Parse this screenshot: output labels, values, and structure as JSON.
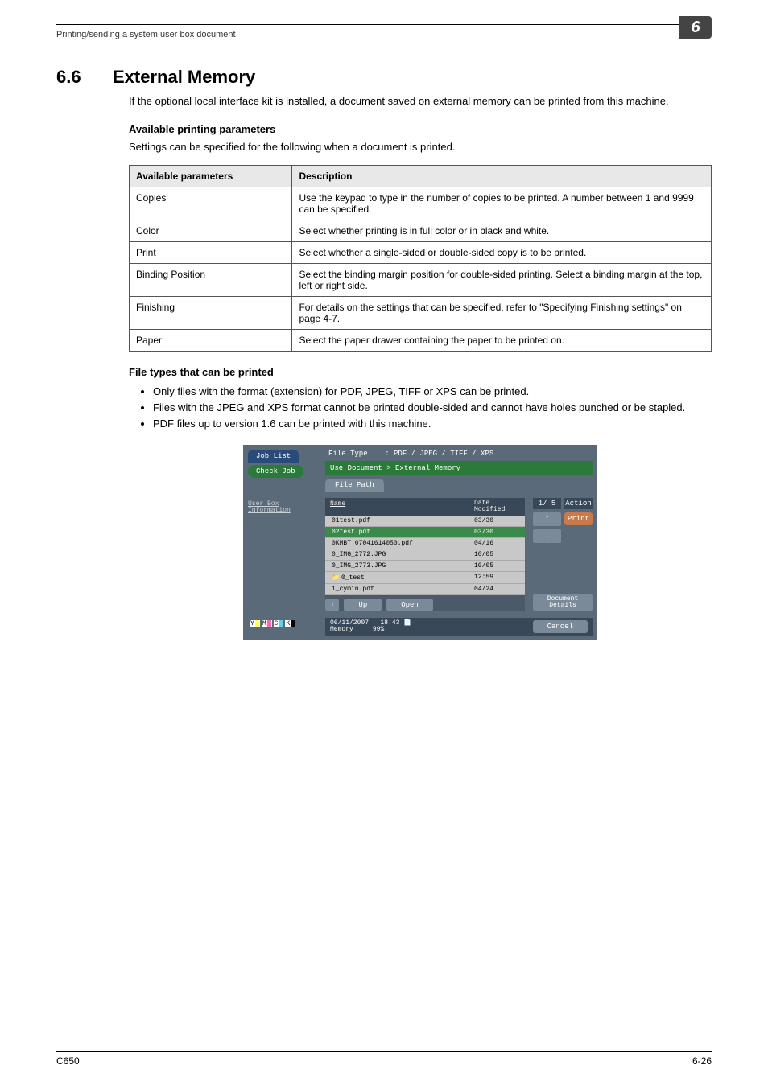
{
  "header": {
    "breadcrumb": "Printing/sending a system user box document",
    "chapter": "6"
  },
  "section": {
    "number": "6.6",
    "title": "External Memory",
    "intro": "If the optional local interface kit is installed, a document saved on external memory can be printed from this machine."
  },
  "params_section": {
    "heading": "Available printing parameters",
    "lead": "Settings can be specified for the following when a document is printed.",
    "th1": "Available parameters",
    "th2": "Description",
    "rows": [
      {
        "p": "Copies",
        "d": "Use the keypad to type in the number of copies to be printed. A number between 1 and 9999 can be specified."
      },
      {
        "p": "Color",
        "d": "Select whether printing is in full color or in black and white."
      },
      {
        "p": "Print",
        "d": "Select whether a single-sided or double-sided copy is to be printed."
      },
      {
        "p": "Binding Position",
        "d": "Select the binding margin position for double-sided printing. Select a binding margin at the top, left or right side."
      },
      {
        "p": "Finishing",
        "d": "For details on the settings that can be specified, refer to \"Specifying Finishing settings\" on page 4-7."
      },
      {
        "p": "Paper",
        "d": "Select the paper drawer containing the paper to be printed on."
      }
    ]
  },
  "filetypes": {
    "heading": "File types that can be printed",
    "bullets": [
      "Only files with the format (extension) for PDF, JPEG, TIFF or XPS can be printed.",
      "Files with the JPEG and XPS format cannot be printed double-sided and cannot have holes punched or be stapled.",
      "PDF files up to version 1.6 can be printed with this machine."
    ]
  },
  "screenshot": {
    "job_list": "Job List",
    "check_job": "Check Job",
    "file_type_label": "File Type",
    "file_type_val": ": PDF / JPEG / TIFF / XPS",
    "crumb": "Use Document > External Memory",
    "file_path_tab": "File Path",
    "user_box_info": "User Box\nInformation",
    "col_name": "Name",
    "col_date": "Date\nModified",
    "files": [
      {
        "n": "01test.pdf",
        "d": "03/30",
        "sel": false
      },
      {
        "n": "02test.pdf",
        "d": "03/30",
        "sel": true
      },
      {
        "n": "0KMBT_07041614050.pdf",
        "d": "04/16",
        "sel": false
      },
      {
        "n": "0_IMG_2772.JPG",
        "d": "10/05",
        "sel": false
      },
      {
        "n": "0_IMG_2773.JPG",
        "d": "10/05",
        "sel": false
      },
      {
        "n": "0_test",
        "d": "12:59",
        "sel": false,
        "folder": true
      },
      {
        "n": "1_cymin.pdf",
        "d": "04/24",
        "sel": false
      }
    ],
    "page_indicator": "1/ 5",
    "action_label": "Action",
    "print_btn": "Print",
    "up_btn": "Up",
    "open_btn": "Open",
    "doc_details_btn": "Document\nDetails",
    "cancel_btn": "Cancel",
    "status_date": "06/11/2007",
    "status_time": "18:43",
    "status_mem_label": "Memory",
    "status_mem_val": "99%"
  },
  "footer": {
    "left": "C650",
    "right": "6-26"
  }
}
